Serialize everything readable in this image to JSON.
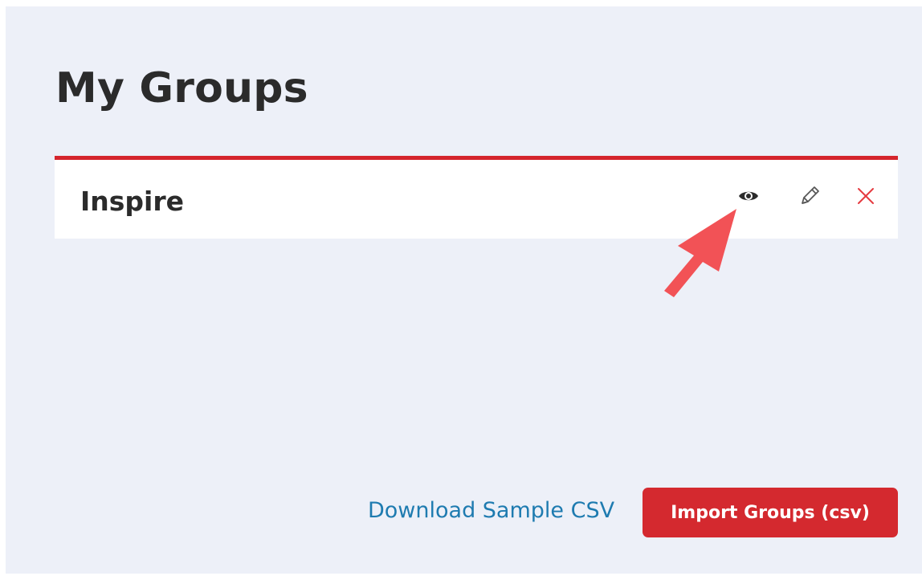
{
  "page": {
    "title": "My Groups"
  },
  "groups": [
    {
      "name": "Inspire",
      "actions": {
        "view_icon": "eye-icon",
        "edit_icon": "pencil-icon",
        "delete_icon": "close-icon"
      }
    }
  ],
  "footer": {
    "download_label": "Download Sample CSV",
    "import_label": "Import Groups (csv)"
  },
  "colors": {
    "background": "#edf0f8",
    "accent_red": "#d5252d",
    "link_blue": "#1e7bb0",
    "title_text": "#2b2b2b",
    "annotation_arrow": "#f25256"
  },
  "annotation": {
    "icon": "pointer-arrow-icon"
  }
}
